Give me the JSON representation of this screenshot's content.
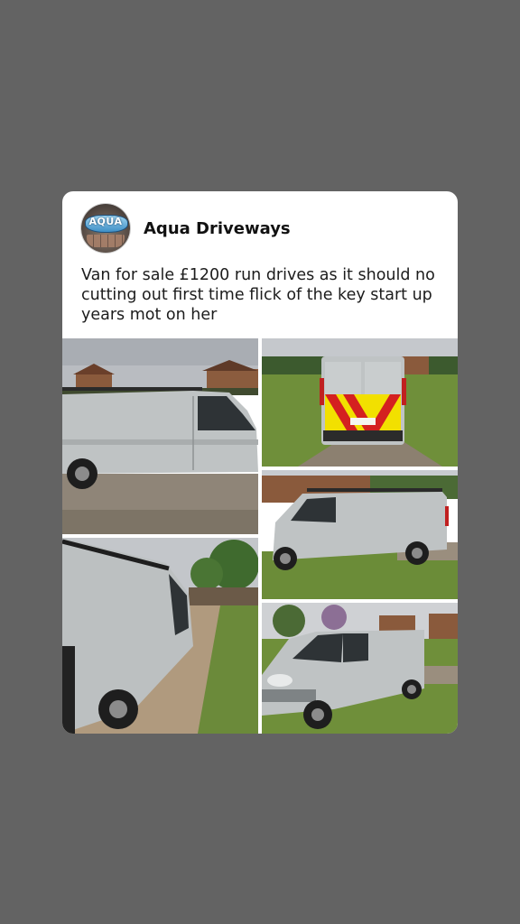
{
  "post": {
    "author": "Aqua Driveways",
    "avatar_logo_text": "AQUA",
    "text": "Van for sale £1200 run drives as it should no cutting out first time flick of the key start up years mot on her",
    "photos": [
      {
        "icon": "van-side-view-photo"
      },
      {
        "icon": "van-rear-view-photo"
      },
      {
        "icon": "van-side-on-grass-photo"
      },
      {
        "icon": "van-side-closeup-photo"
      },
      {
        "icon": "van-front-quarter-photo"
      }
    ]
  },
  "colors": {
    "page_background": "#636363",
    "card_background": "#ffffff",
    "van_silver": "#bfc3c4",
    "chevron_red": "#d42020",
    "chevron_yellow": "#f2e000",
    "grass": "#6f8f3a",
    "sky": "#c9ccd0"
  }
}
